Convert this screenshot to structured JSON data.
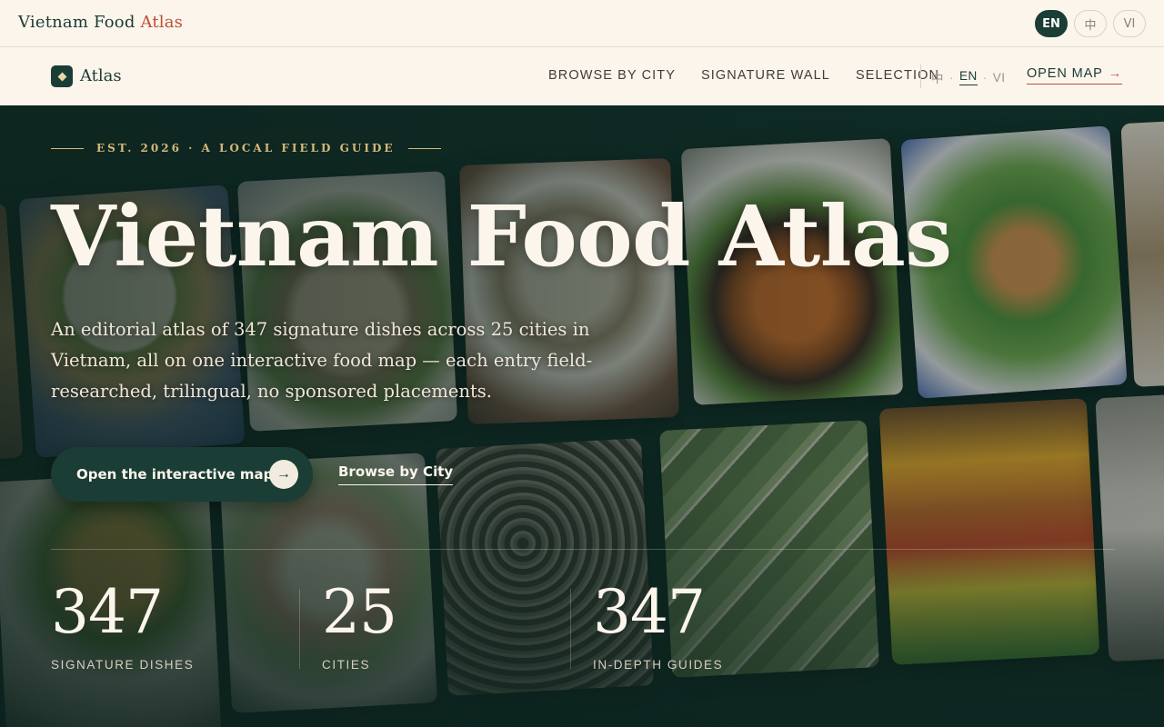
{
  "topbar": {
    "brand_main": "Vietnam Food",
    "brand_accent": "Atlas",
    "languages": [
      {
        "label": "EN",
        "active": true
      },
      {
        "label": "中",
        "active": false
      },
      {
        "label": "VI",
        "active": false
      }
    ]
  },
  "nav": {
    "title": "Atlas",
    "links": [
      "BROWSE BY CITY",
      "SIGNATURE WALL",
      "SELECTION"
    ],
    "lang_zh": "中",
    "lang_en": "EN",
    "lang_vi": "VI",
    "open_map": "OPEN MAP",
    "open_map_arrow": "→"
  },
  "hero": {
    "eyebrow": "EST. 2026 · A LOCAL FIELD GUIDE",
    "title": "Vietnam Food Atlas",
    "description": "An editorial atlas of 347 signature dishes across 25 cities in Vietnam, all on one interactive food map — each entry field-researched, trilingual, no sponsored placements.",
    "cta_label": "Open the interactive map",
    "cta_arrow": "→",
    "secondary_link": "Browse by City",
    "stats": [
      {
        "value": "347",
        "label": "SIGNATURE DISHES"
      },
      {
        "value": "25",
        "label": "CITIES"
      },
      {
        "value": "347",
        "label": "IN-DEPTH GUIDES"
      }
    ]
  },
  "colors": {
    "cream": "#fbf5ec",
    "forest": "#1a3d35",
    "hero_bg": "#0f2b25",
    "accent_red": "#c14d35",
    "gold": "#d6b878"
  }
}
